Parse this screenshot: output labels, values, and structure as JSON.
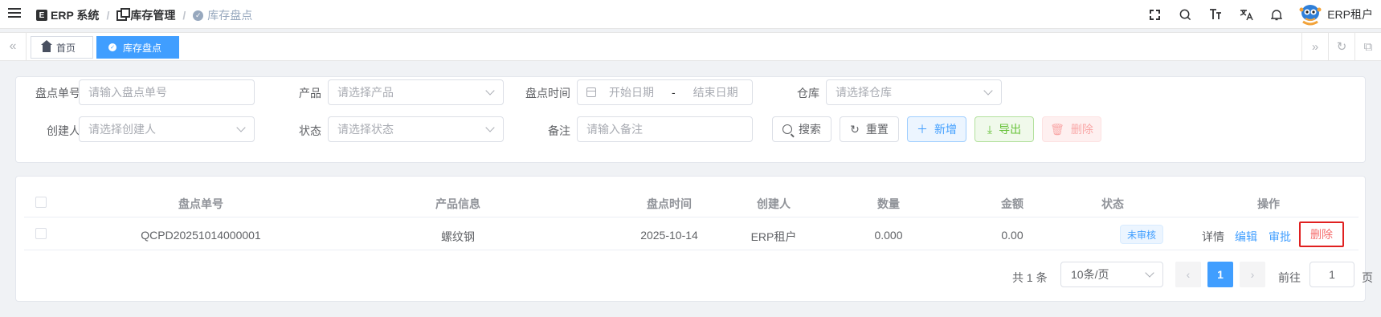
{
  "navbar": {
    "breadcrumbs": [
      "ERP 系统",
      "库存管理",
      "库存盘点"
    ],
    "separator": "/",
    "user_name": "ERP租户",
    "icons": [
      "hamburger-icon",
      "fullscreen-icon",
      "search-icon",
      "font-size-icon",
      "translate-icon",
      "bell-icon"
    ]
  },
  "tags": {
    "home_label": "首页",
    "active_label": "库存盘点"
  },
  "search_form": {
    "order_no_label": "盘点单号",
    "order_no_placeholder": "请输入盘点单号",
    "product_label": "产品",
    "product_placeholder": "请选择产品",
    "time_label": "盘点时间",
    "start_placeholder": "开始日期",
    "range_sep": "-",
    "end_placeholder": "结束日期",
    "warehouse_label": "仓库",
    "warehouse_placeholder": "请选择仓库",
    "creator_label": "创建人",
    "creator_placeholder": "请选择创建人",
    "status_label": "状态",
    "status_placeholder": "请选择状态",
    "remark_label": "备注",
    "remark_placeholder": "请输入备注",
    "buttons": {
      "search": "搜索",
      "reset": "重置",
      "add": "新增",
      "export": "导出",
      "delete": "删除"
    }
  },
  "table": {
    "headers": [
      "盘点单号",
      "产品信息",
      "盘点时间",
      "创建人",
      "数量",
      "金额",
      "状态",
      "操作"
    ],
    "rows": [
      {
        "order_no": "QCPD20251014000001",
        "product": "螺纹钢",
        "time": "2025-10-14",
        "creator": "ERP租户",
        "quantity": "0.000",
        "amount": "0.00",
        "status": "未审核",
        "actions": [
          "详情",
          "编辑",
          "审批",
          "删除"
        ]
      }
    ]
  },
  "pagination": {
    "total": "共 1 条",
    "page_size": "10条/页",
    "current_page": "1",
    "prev": "‹",
    "next": "›",
    "goto_label": "前往",
    "goto_value": "1",
    "page_suffix": "页"
  },
  "colors": {
    "primary": "#409eff",
    "success": "#67c23a",
    "danger": "#f56c6c",
    "highlight_box": "#e02020"
  }
}
